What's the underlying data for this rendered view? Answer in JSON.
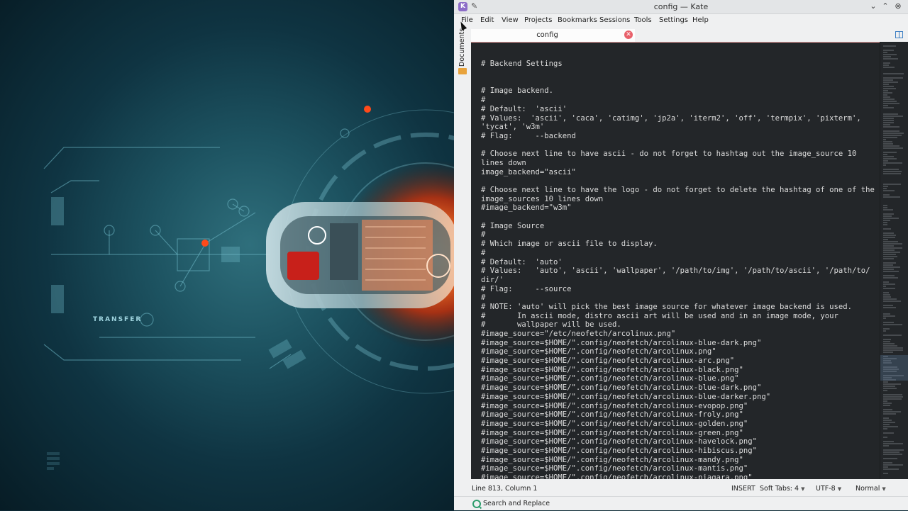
{
  "wallpaper": {
    "transfer_label": "TRANSFER"
  },
  "window": {
    "title": "config — Kate"
  },
  "menu": [
    "File",
    "Edit",
    "View",
    "Projects",
    "Bookmarks",
    "Sessions",
    "Tools",
    "Settings",
    "Help"
  ],
  "sidebar": {
    "documents_label": "Documents"
  },
  "tabs": [
    {
      "label": "config"
    }
  ],
  "editor": {
    "lines": [
      "",
      "",
      "# Backend Settings",
      "",
      "",
      "# Image backend.",
      "#",
      "# Default:  'ascii'",
      "# Values:  'ascii', 'caca', 'catimg', 'jp2a', 'iterm2', 'off', 'termpix', 'pixterm',",
      "'tycat', 'w3m'",
      "# Flag:     --backend",
      "",
      "# Choose next line to have ascii - do not forget to hashtag out the image_source 10",
      "lines down",
      "image_backend=\"ascii\"",
      "",
      "# Choose next line to have the logo - do not forget to delete the hashtag of one of the",
      "image_sources 10 lines down",
      "#image_backend=\"w3m\"",
      "",
      "# Image Source",
      "#",
      "# Which image or ascii file to display.",
      "#",
      "# Default:  'auto'",
      "# Values:   'auto', 'ascii', 'wallpaper', '/path/to/img', '/path/to/ascii', '/path/to/",
      "dir/'",
      "# Flag:     --source",
      "#",
      "# NOTE: 'auto' will pick the best image source for whatever image backend is used.",
      "#       In ascii mode, distro ascii art will be used and in an image mode, your",
      "#       wallpaper will be used.",
      "#image_source=\"/etc/neofetch/arcolinux.png\"",
      "#image_source=$HOME/\".config/neofetch/arcolinux-blue-dark.png\"",
      "#image_source=$HOME/\".config/neofetch/arcolinux.png\"",
      "#image_source=$HOME/\".config/neofetch/arcolinux-arc.png\"",
      "#image_source=$HOME/\".config/neofetch/arcolinux-black.png\"",
      "#image_source=$HOME/\".config/neofetch/arcolinux-blue.png\"",
      "#image_source=$HOME/\".config/neofetch/arcolinux-blue-dark.png\"",
      "#image_source=$HOME/\".config/neofetch/arcolinux-blue-darker.png\"",
      "#image_source=$HOME/\".config/neofetch/arcolinux-evopop.png\"",
      "#image_source=$HOME/\".config/neofetch/arcolinux-froly.png\"",
      "#image_source=$HOME/\".config/neofetch/arcolinux-golden.png\"",
      "#image_source=$HOME/\".config/neofetch/arcolinux-green.png\"",
      "#image_source=$HOME/\".config/neofetch/arcolinux-havelock.png\"",
      "#image_source=$HOME/\".config/neofetch/arcolinux-hibiscus.png\"",
      "#image_source=$HOME/\".config/neofetch/arcolinux-mandy.png\"",
      "#image_source=$HOME/\".config/neofetch/arcolinux-mantis.png\"",
      "#image_source=$HOME/\".config/neofetch/arcolinux-niagara.png\""
    ]
  },
  "statusbar": {
    "position": "Line 813, Column 1",
    "mode": "INSERT",
    "indent": "Soft Tabs: 4",
    "encoding": "UTF-8",
    "highlight": "Normal"
  },
  "bottom_panel": {
    "search_label": "Search and Replace"
  },
  "colors": {
    "editor_bg": "#232629",
    "tab_accent": "#f0a3a3",
    "close_red": "#e8606a",
    "glow_orange": "#ff5a1f"
  }
}
